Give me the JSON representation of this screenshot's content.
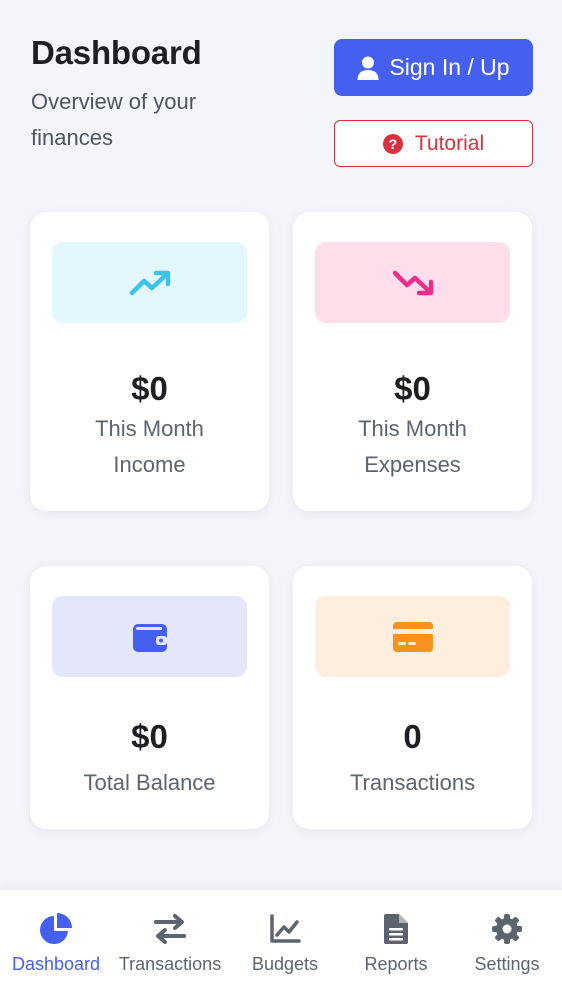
{
  "header": {
    "title": "Dashboard",
    "subtitle": "Overview of your finances",
    "signin_label": "Sign In / Up",
    "tutorial_label": "Tutorial"
  },
  "cards": [
    {
      "id": "income",
      "value": "$0",
      "label": "This Month Income",
      "icon": "trending-up-icon",
      "icon_color": "#3cc3ec",
      "bg_color": "#e3f7fc"
    },
    {
      "id": "expenses",
      "value": "$0",
      "label": "This Month Expenses",
      "icon": "trending-down-icon",
      "icon_color": "#ea2e8a",
      "bg_color": "#fddeea"
    },
    {
      "id": "balance",
      "value": "$0",
      "label": "Total Balance",
      "icon": "wallet-icon",
      "icon_color": "#4560ee",
      "bg_color": "#e4e6fb"
    },
    {
      "id": "transactions",
      "value": "0",
      "label": "Transactions",
      "icon": "credit-card-icon",
      "icon_color": "#f7921e",
      "bg_color": "#fdeede"
    }
  ],
  "nav": {
    "active": "Dashboard",
    "items": [
      {
        "label": "Dashboard",
        "icon": "pie-chart-icon"
      },
      {
        "label": "Transactions",
        "icon": "swap-arrows-icon"
      },
      {
        "label": "Budgets",
        "icon": "line-chart-icon"
      },
      {
        "label": "Reports",
        "icon": "document-icon"
      },
      {
        "label": "Settings",
        "icon": "gear-icon"
      }
    ]
  },
  "colors": {
    "accent": "#4560ee",
    "danger": "#d9323e",
    "background": "#f4f5fa",
    "nav_inactive": "#5d6470"
  }
}
